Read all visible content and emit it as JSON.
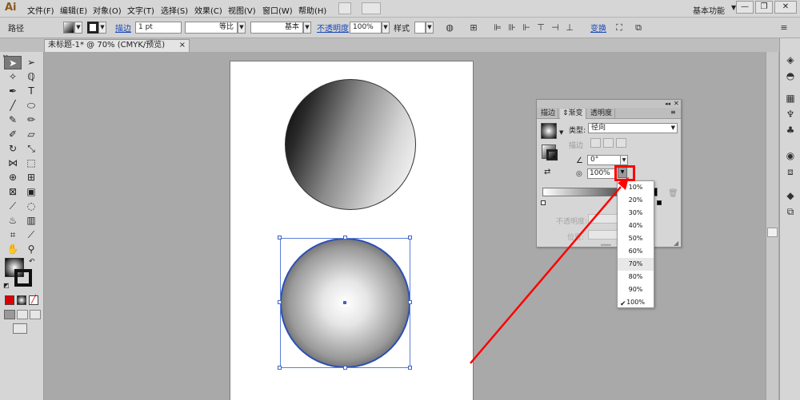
{
  "app": {
    "logo": "Ai"
  },
  "menu": {
    "items": [
      "文件(F)",
      "编辑(E)",
      "对象(O)",
      "文字(T)",
      "选择(S)",
      "效果(C)",
      "视图(V)",
      "窗口(W)",
      "帮助(H)"
    ],
    "workspace": "基本功能"
  },
  "window_controls": {
    "minimize": "—",
    "restore": "❐",
    "close": "✕"
  },
  "control_bar": {
    "selection_label": "路径",
    "stroke_link": "描边",
    "stroke_weight": "1 pt",
    "profile_label": "等比",
    "brush_label": "基本",
    "opacity_link": "不透明度",
    "opacity_value": "100%",
    "style_label": "样式",
    "transform_link": "变换"
  },
  "document": {
    "tab_title": "未标题-1* @ 70% (CMYK/预览)",
    "tab_close": "×"
  },
  "gradient_panel": {
    "tabs": [
      "描边",
      "渐变",
      "透明度"
    ],
    "type_label": "类型",
    "type_value": "径向",
    "stroke_label": "描边",
    "angle_value": "0°",
    "aspect_value": "100%",
    "opacity_label": "不透明度",
    "location_label": "位置"
  },
  "aspect_dropdown": {
    "options": [
      "10%",
      "20%",
      "30%",
      "40%",
      "50%",
      "60%",
      "70%",
      "80%",
      "90%",
      "100%"
    ],
    "hovered": "70%",
    "selected": "100%"
  },
  "colors": {
    "accent_red": "#ff0000",
    "selection_blue": "#3e63c9"
  }
}
